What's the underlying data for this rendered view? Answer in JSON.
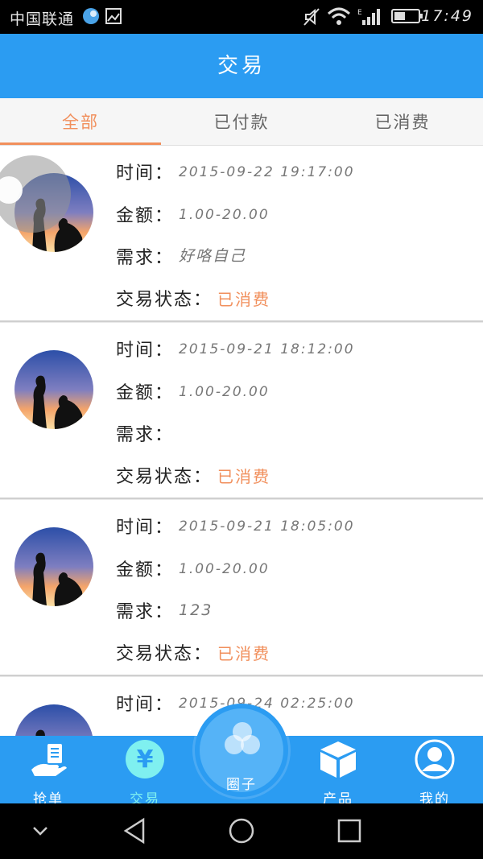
{
  "status_bar": {
    "carrier": "中国联通",
    "time": "17:49",
    "icons": [
      "chat-bubble-icon",
      "image-icon",
      "mute-icon",
      "wifi-icon",
      "signal-icon",
      "battery-icon"
    ]
  },
  "header": {
    "title": "交易"
  },
  "tabs": [
    {
      "label": "全部",
      "active": true
    },
    {
      "label": "已付款",
      "active": false
    },
    {
      "label": "已消费",
      "active": false
    }
  ],
  "labels": {
    "time": "时间：",
    "amount": "金额：",
    "demand": "需求：",
    "status": "交易状态："
  },
  "transactions": [
    {
      "time": "2015-09-22  19:17:00",
      "amount": "1.00-20.00",
      "demand": "好咯自己",
      "status": "已消费"
    },
    {
      "time": "2015-09-21  18:12:00",
      "amount": "1.00-20.00",
      "demand": "",
      "status": "已消费"
    },
    {
      "time": "2015-09-21  18:05:00",
      "amount": "1.00-20.00",
      "demand": "123",
      "status": "已消费"
    },
    {
      "time": "2015-09-24  02:25:00",
      "amount": "",
      "demand": "",
      "status": ""
    }
  ],
  "bottom_nav": {
    "items": [
      {
        "label": "抢单",
        "icon": "hand-document-icon",
        "active": false
      },
      {
        "label": "交易",
        "icon": "yen-icon",
        "active": true
      },
      {
        "label": "产品",
        "icon": "box-icon",
        "active": false
      },
      {
        "label": "我的",
        "icon": "user-icon",
        "active": false
      }
    ],
    "center": {
      "label": "圈子",
      "icon": "circles-icon"
    }
  },
  "colors": {
    "brand_blue": "#2b9cf2",
    "accent_orange": "#f18f5c",
    "active_nav": "#7ff0f0"
  }
}
